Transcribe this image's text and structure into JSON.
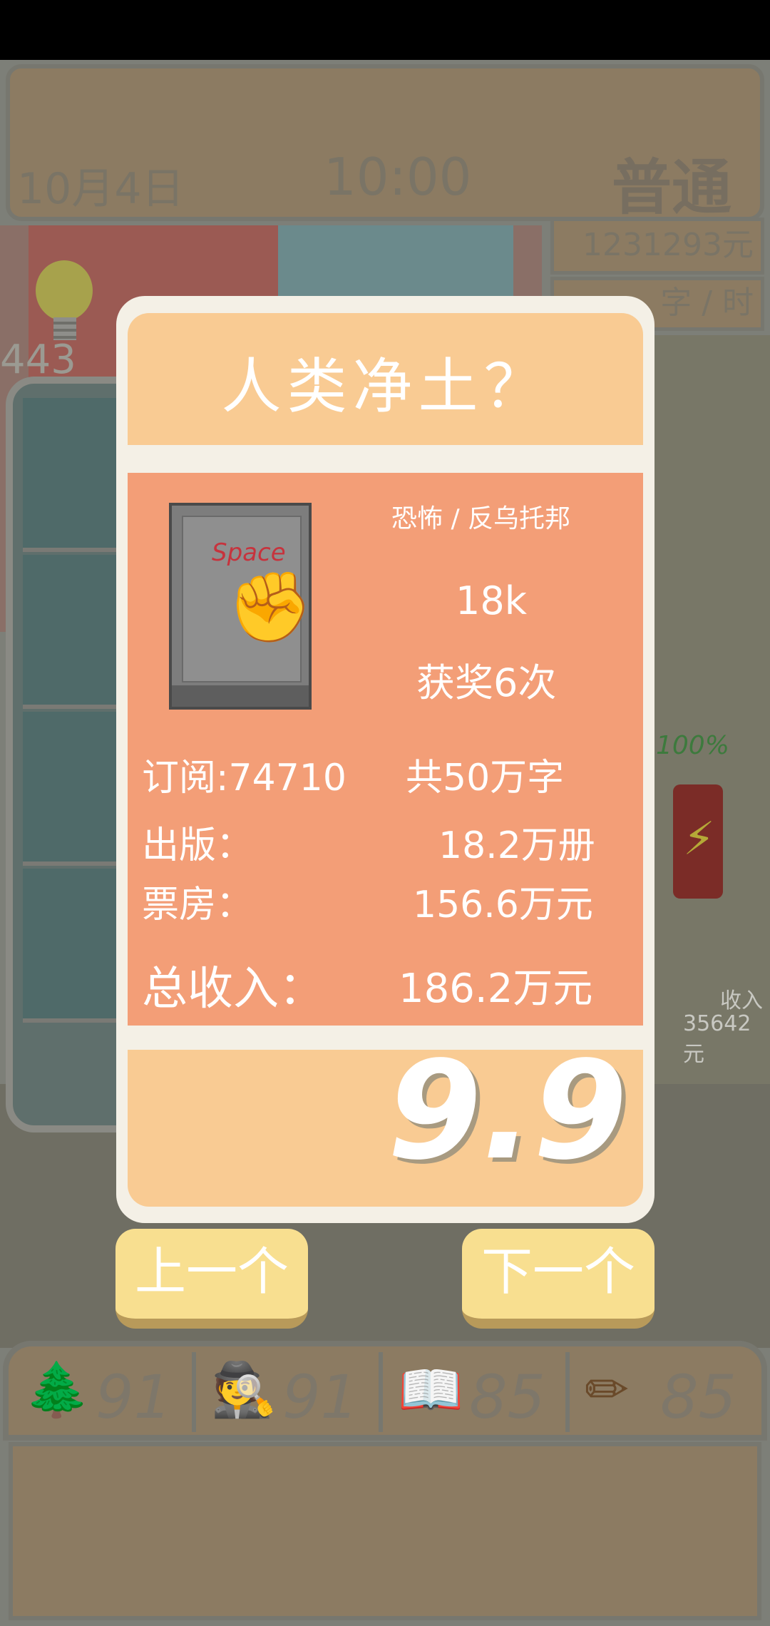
{
  "topbar": {
    "date": "10月4日",
    "time": "10:00",
    "mode": "普通"
  },
  "money": "1231293元",
  "speed": "字 / 时",
  "background": {
    "counter": "443",
    "energy_percent": "100%",
    "income_label": "收入",
    "income_value": "35642元"
  },
  "book": {
    "title": "人类净土？",
    "genre": "恐怖 / 反乌托邦",
    "popularity": "18k",
    "awards": "获奖6次",
    "subscriptions": "订阅:74710",
    "total_words": "共50万字",
    "publish_label": "出版：",
    "publish_value": "18.2万册",
    "boxoffice_label": "票房：",
    "boxoffice_value": "156.6万元",
    "income_label": "总收入：",
    "income_value": "186.2万元",
    "score": "9.9",
    "cover_mark": "Space"
  },
  "nav": {
    "prev_label": "上一个",
    "next_label": "下一个"
  },
  "stats": [
    {
      "icon": "tree-icon",
      "value": "91"
    },
    {
      "icon": "detective-icon",
      "value": "91"
    },
    {
      "icon": "book-icon",
      "value": "85"
    },
    {
      "icon": "pencil-icon",
      "value": "85"
    }
  ]
}
